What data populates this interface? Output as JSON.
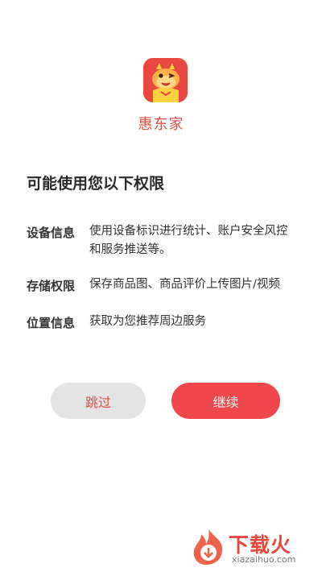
{
  "app": {
    "name": "惠东家",
    "logo_icon": "dragon-mascot-icon",
    "brand_color": "#e8483e"
  },
  "dialog": {
    "title": "可能使用您以下权限",
    "permissions": [
      {
        "label": "设备信息",
        "lines": [
          "使用设备标识进行统计、账户安全风控",
          "和服务推送等。"
        ]
      },
      {
        "label": "存储权限",
        "lines": [
          "保存商品图、商品评价上传图片/视频"
        ]
      },
      {
        "label": "位置信息",
        "lines": [
          "获取为您推荐周边服务"
        ]
      }
    ],
    "buttons": {
      "skip": "跳过",
      "continue": "继续"
    }
  },
  "watermark": {
    "text": "下载火",
    "sub": "xiazaihuo.com",
    "icon": "flame-download-icon"
  }
}
